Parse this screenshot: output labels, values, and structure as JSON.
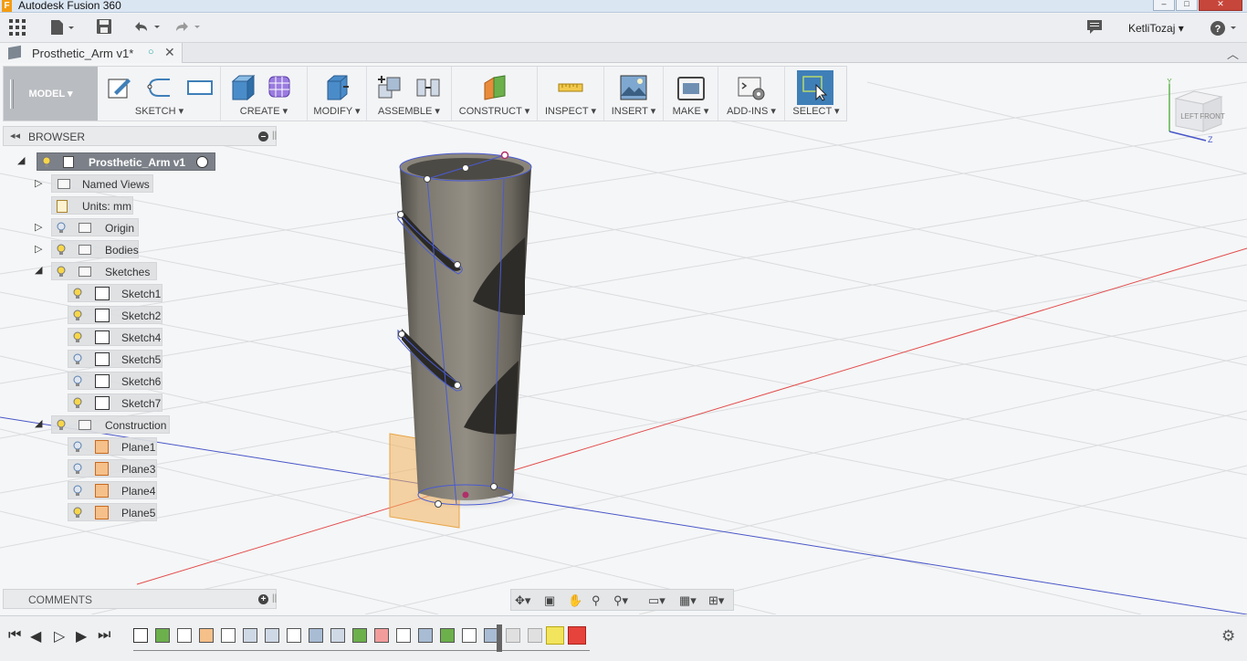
{
  "window": {
    "title": "Autodesk Fusion 360",
    "min_icon": "minimize-icon",
    "max_icon": "maximize-icon",
    "close_icon": "close-icon"
  },
  "quick_access": {
    "user": "KetliTozaj ▾",
    "help": "?"
  },
  "document_tab": {
    "name": "Prosthetic_Arm v1*"
  },
  "toolbar": {
    "mode": "MODEL",
    "groups": [
      "SKETCH",
      "CREATE",
      "MODIFY",
      "ASSEMBLE",
      "CONSTRUCT",
      "INSPECT",
      "INSERT",
      "MAKE",
      "ADD-INS",
      "SELECT"
    ]
  },
  "browser": {
    "title": "BROWSER",
    "root": "Prosthetic_Arm v1",
    "items": {
      "named_views": "Named Views",
      "units": "Units: mm",
      "origin": "Origin",
      "bodies": "Bodies",
      "sketches": "Sketches",
      "construction": "Construction"
    },
    "sketches": [
      "Sketch1",
      "Sketch2",
      "Sketch4",
      "Sketch5",
      "Sketch6",
      "Sketch7"
    ],
    "planes": [
      "Plane1",
      "Plane3",
      "Plane4",
      "Plane5"
    ]
  },
  "view_cube": {
    "left": "LEFT",
    "front": "FRONT",
    "y": "Y",
    "z": "Z"
  },
  "comments": {
    "title": "COMMENTS"
  },
  "colors": {
    "accent": "#3f7fb8",
    "plane": "#f2b35d",
    "axis_red": "#e34b4b",
    "axis_blue": "#4856c8"
  }
}
